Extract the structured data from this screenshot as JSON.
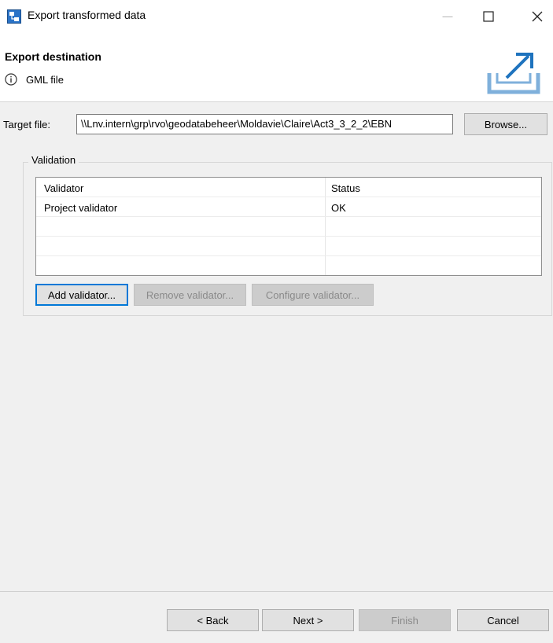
{
  "window": {
    "title": "Export transformed data",
    "minimize_glyph": "—",
    "maximize_glyph": "☐",
    "close_glyph": "✕"
  },
  "header": {
    "title": "Export destination",
    "message": "GML file",
    "info_icon": "info-icon",
    "graphic_icon": "export-icon"
  },
  "target": {
    "label": "Target file:",
    "value": "\\\\Lnv.intern\\grp\\rvo\\geodatabeheer\\Moldavie\\Claire\\Act3_3_2_2\\EBN",
    "browse_label": "Browse..."
  },
  "validation": {
    "legend": "Validation",
    "columns": [
      "Validator",
      "Status"
    ],
    "rows": [
      {
        "validator": "Project validator",
        "status": "OK"
      }
    ],
    "add_label": "Add validator...",
    "remove_label": "Remove validator...",
    "configure_label": "Configure validator..."
  },
  "footer": {
    "back_label": "< Back",
    "next_label": "Next >",
    "finish_label": "Finish",
    "cancel_label": "Cancel"
  },
  "colors": {
    "focus_accent": "#0078d7",
    "icon_blue": "#1e73be"
  }
}
